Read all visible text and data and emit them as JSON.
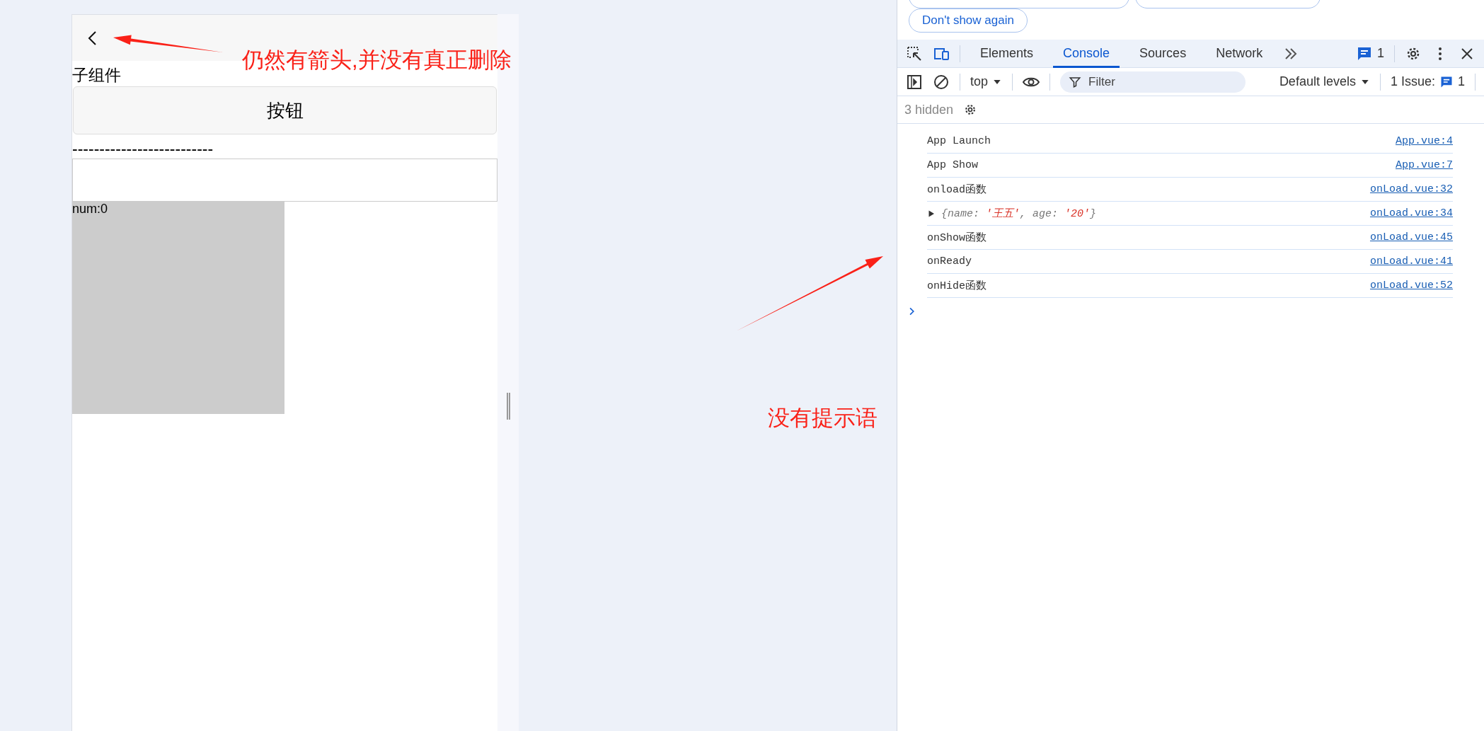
{
  "preview": {
    "heading": "子组件",
    "button": "按钮",
    "divider_text": "--------------------------",
    "box_text": "num:0"
  },
  "devtools": {
    "top_buttons": [
      "Don't show again"
    ],
    "tabs": [
      {
        "label": "Elements",
        "selected": false
      },
      {
        "label": "Console",
        "selected": true
      },
      {
        "label": "Sources",
        "selected": false
      },
      {
        "label": "Network",
        "selected": false
      }
    ],
    "messages_count": "1",
    "context": "top",
    "filter": {
      "placeholder": "Filter"
    },
    "levels": "Default levels",
    "issues": {
      "label": "1 Issue:",
      "count": "1"
    },
    "hidden": "3 hidden",
    "rows": [
      {
        "kind": "log",
        "text": "App Launch",
        "source": "App.vue:4"
      },
      {
        "kind": "log",
        "text": "App Show",
        "source": "App.vue:7"
      },
      {
        "kind": "log",
        "text": "onload函数",
        "source": "onLoad.vue:32"
      },
      {
        "kind": "object",
        "expanded": false,
        "parts": [
          {
            "kind": "key",
            "text": "{name: "
          },
          {
            "kind": "string",
            "text": "'王五'"
          },
          {
            "kind": "key",
            "text": ", age: "
          },
          {
            "kind": "string",
            "text": "'20'"
          },
          {
            "kind": "key",
            "text": "}"
          }
        ],
        "source": "onLoad.vue:34"
      },
      {
        "kind": "log",
        "text": "onShow函数",
        "source": "onLoad.vue:45"
      },
      {
        "kind": "log",
        "text": "onReady",
        "source": "onLoad.vue:41"
      },
      {
        "kind": "log",
        "text": "onHide函数",
        "source": "onLoad.vue:52"
      }
    ]
  },
  "annotations": [
    {
      "text": "仍然有箭头,并没有真正删除"
    },
    {
      "text": "没有提示语"
    }
  ]
}
